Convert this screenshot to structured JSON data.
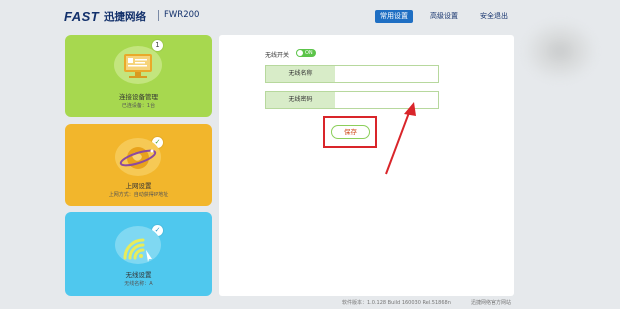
{
  "header": {
    "brand": "FAST",
    "brand_cn": "迅捷网络",
    "model": "FWR200",
    "nav": [
      {
        "label": "常用设置",
        "active": true
      },
      {
        "label": "高级设置",
        "active": false
      },
      {
        "label": "安全退出",
        "active": false
      }
    ]
  },
  "tiles": [
    {
      "label": "连接设备管理",
      "sub": "已连设备：1台",
      "badge": "1",
      "color": "#a7d84f",
      "icon": "monitor-icon"
    },
    {
      "label": "上网设置",
      "sub": "上网方式：自动获得IP地址",
      "badge": "✓",
      "color": "#f2b62c",
      "icon": "globe-icon"
    },
    {
      "label": "无线设置",
      "sub": "无线名称：A",
      "badge": "✓",
      "color": "#4fc8ee",
      "icon": "wifi-icon"
    }
  ],
  "wireless": {
    "switch_label": "无线开关",
    "switch_state": "ON",
    "ssid_label": "无线名称",
    "ssid_value": "",
    "password_label": "无线密码",
    "password_value": "",
    "save_label": "保存"
  },
  "footer": {
    "version": "软件版本：1.0.128 Build 160030 Rel.51868n",
    "support": "迅捷网络官方网站"
  },
  "colors": {
    "accent": "#1f6fc3",
    "highlight": "#d9252a"
  }
}
